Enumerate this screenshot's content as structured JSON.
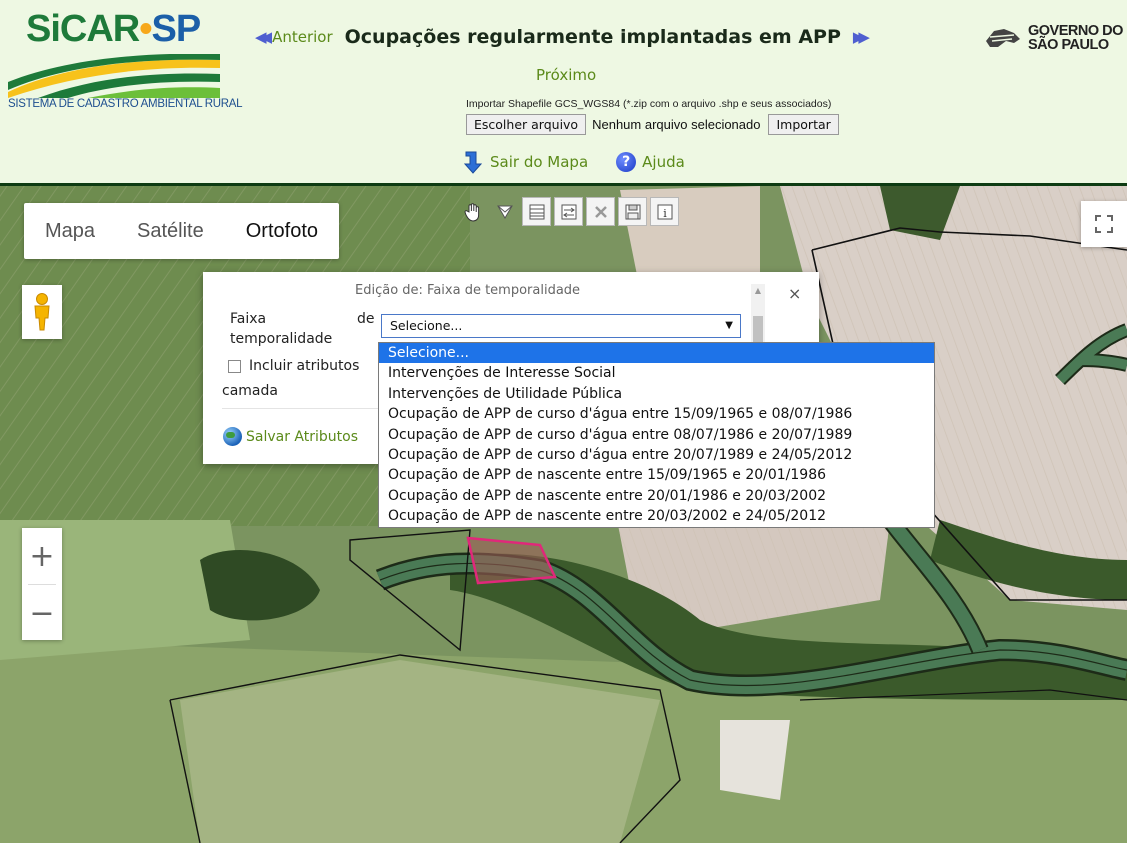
{
  "header": {
    "logo": {
      "name": "SiCAR",
      "suffix": "SP",
      "subtitle": "SISTEMA DE CADASTRO AMBIENTAL RURAL"
    },
    "nav": {
      "previous_label": "Anterior",
      "next_label": "Próximo"
    },
    "title": "Ocupações regularmente implantadas em APP",
    "import": {
      "label": "Importar Shapefile GCS_WGS84 (*.zip com o arquivo .shp e seus associados)",
      "choose_file_label": "Escolher arquivo",
      "no_file_label": "Nenhum arquivo selecionado",
      "import_button_label": "Importar"
    },
    "exit_map_label": "Sair do Mapa",
    "help_label": "Ajuda",
    "gov_logo": {
      "line1": "GOVERNO DO",
      "line2": "SÃO PAULO"
    }
  },
  "map": {
    "type_buttons": [
      "Mapa",
      "Satélite",
      "Ortofoto"
    ],
    "active_type": "Ortofoto",
    "tools": [
      "hand-pan-icon",
      "select-arrow-icon",
      "table-icon",
      "split-icon",
      "delete-icon",
      "save-disk-icon",
      "info-icon"
    ],
    "zoom_in": "+",
    "zoom_out": "−"
  },
  "dialog": {
    "title": "Edição de: Faixa de temporalidade",
    "close": "×",
    "field_label_part1": "Faixa",
    "field_label_de": "de",
    "field_label_part2": "temporalidade",
    "select_value": "Selecione...",
    "checkbox_label": "Incluir atributos",
    "checkbox_label_cont": "camada",
    "save_label": "Salvar Atributos"
  },
  "dropdown": {
    "options": [
      "Selecione...",
      "Intervenções de Interesse Social",
      "Intervenções de Utilidade Pública",
      "Ocupação de APP de curso d'água entre 15/09/1965 e 08/07/1986",
      "Ocupação de APP de curso d'água entre 08/07/1986 e 20/07/1989",
      "Ocupação de APP de curso d'água entre 20/07/1989 e 24/05/2012",
      "Ocupação de APP de nascente entre 15/09/1965 e 20/01/1986",
      "Ocupação de APP de nascente entre 20/01/1986 e 20/03/2002",
      "Ocupação de APP de nascente entre 20/03/2002 e 24/05/2012"
    ],
    "selected_index": 0
  },
  "colors": {
    "header_bg": "#eef8e3",
    "header_border": "#0d3b12",
    "link_green": "#5b8a1a",
    "selected_blue": "#1e73e8",
    "polygon_highlight": "#e0287a"
  }
}
